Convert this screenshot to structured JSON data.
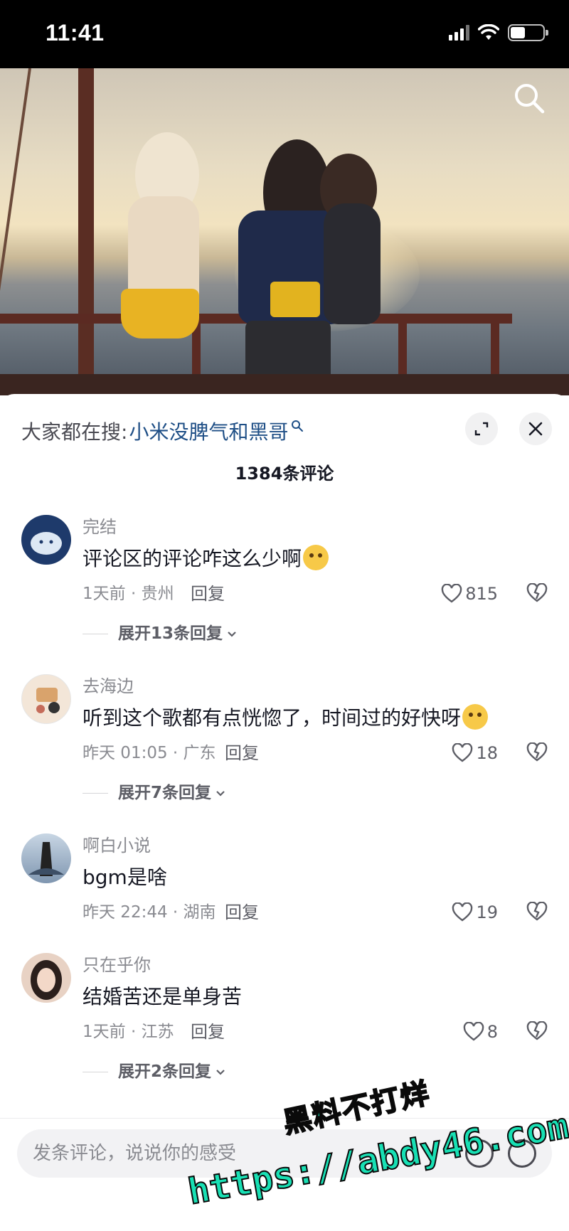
{
  "status_bar": {
    "time": "11:41"
  },
  "video": {
    "search_icon": "search-icon"
  },
  "sheet": {
    "hot_search_prefix": "大家都在搜:",
    "hot_search_query": "小米没脾气和黑哥",
    "comment_count": "1384条评论",
    "reply_label": "回复",
    "comments": [
      {
        "user": "完结",
        "text": "评论区的评论咋这么少啊",
        "meta": "1天前 · 贵州",
        "likes": "815",
        "expand": "展开13条回复",
        "avatar_color": "#1e3a6b"
      },
      {
        "user": "去海边",
        "text": "听到这个歌都有点恍惚了，时间过的好快呀",
        "meta": "昨天 01:05 · 广东",
        "likes": "18",
        "expand": "展开7条回复",
        "avatar_color": "#f3e6d8"
      },
      {
        "user": "啊白小说",
        "text": "bgm是啥",
        "meta": "昨天 22:44 · 湖南",
        "likes": "19",
        "expand": "",
        "avatar_color": "#7f96b0"
      },
      {
        "user": "只在乎你",
        "text": "结婚苦还是单身苦",
        "meta": "1天前 · 江苏",
        "likes": "8",
        "expand": "展开2条回复",
        "avatar_color": "#e8d2c4"
      }
    ]
  },
  "input": {
    "placeholder": "发条评论，说说你的感受"
  },
  "watermark": {
    "line1": "黑料不打烊",
    "line2": "https://abdy46.com"
  }
}
